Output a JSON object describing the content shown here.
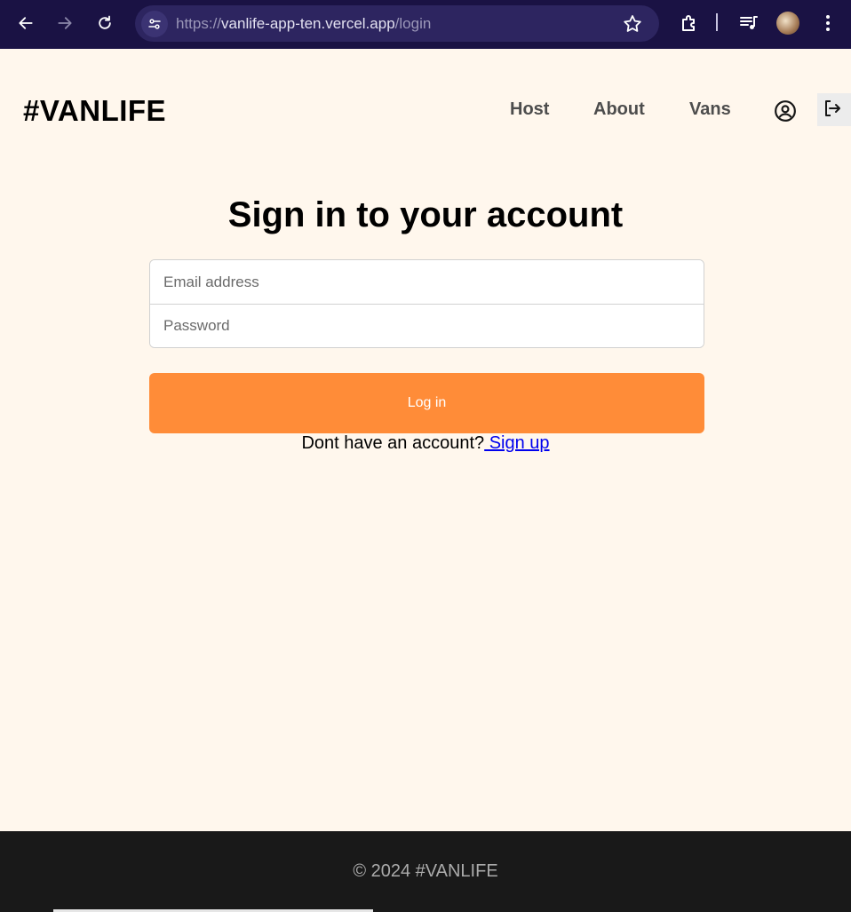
{
  "browser": {
    "url_prefix": "https://",
    "url_host": "vanlife-app-ten.vercel.app",
    "url_path": "/login"
  },
  "header": {
    "logo": "#VANLIFE",
    "nav": [
      "Host",
      "About",
      "Vans"
    ]
  },
  "login": {
    "title": "Sign in to your account",
    "email_placeholder": "Email address",
    "password_placeholder": "Password",
    "button_label": "Log in",
    "signup_prompt": "Dont have an account?",
    "signup_link": " Sign up"
  },
  "footer": {
    "text": "© 2024 #VANLIFE"
  },
  "colors": {
    "page_bg": "#fff7ed",
    "accent": "#ff8c38",
    "footer_bg": "#191919",
    "browser_bg": "#1a1244"
  }
}
